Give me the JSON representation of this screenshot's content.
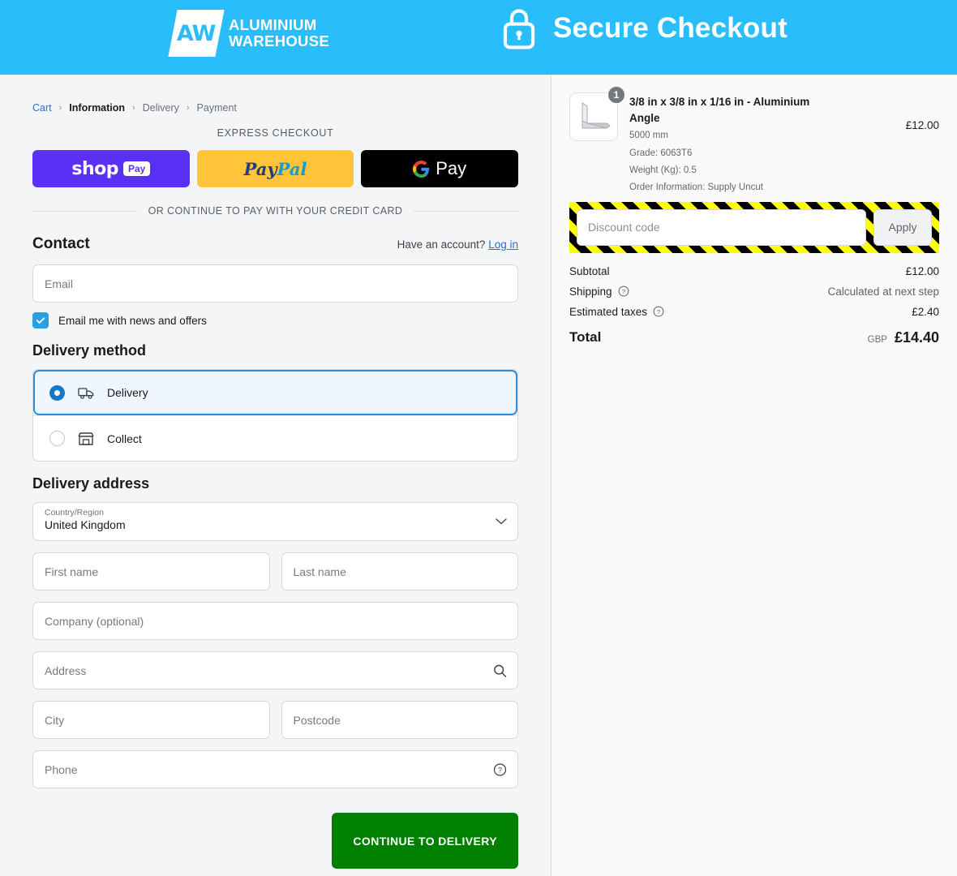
{
  "header": {
    "logo_initials": "AW",
    "brand_line1": "ALUMINIUM",
    "brand_line2": "WAREHOUSE",
    "secure_title": "Secure Checkout",
    "lock_icon": "lock-icon",
    "background_color": "#29bdfb"
  },
  "breadcrumb": {
    "cart": "Cart",
    "information": "Information",
    "delivery": "Delivery",
    "payment": "Payment",
    "separator": "›"
  },
  "express": {
    "title": "EXPRESS CHECKOUT",
    "shop_pay": {
      "word": "shop",
      "chip": "Pay",
      "color": "#5a31f4"
    },
    "paypal": {
      "part1": "Pay",
      "part2": "Pal",
      "color": "#ffc439"
    },
    "gpay": {
      "label": "Pay",
      "color": "#000000"
    },
    "divider_text": "OR CONTINUE TO PAY WITH YOUR CREDIT CARD"
  },
  "contact": {
    "title": "Contact",
    "account_prompt": "Have an account?",
    "login_label": "Log in",
    "email_placeholder": "Email",
    "email_value": "",
    "newsletter_label": "Email me with news and offers",
    "newsletter_checked": true
  },
  "delivery_method": {
    "title": "Delivery method",
    "options": [
      {
        "label": "Delivery",
        "icon": "truck-icon",
        "selected": true
      },
      {
        "label": "Collect",
        "icon": "storefront-icon",
        "selected": false
      }
    ]
  },
  "delivery_address": {
    "title": "Delivery address",
    "country_label": "Country/Region",
    "country_value": "United Kingdom",
    "first_name_placeholder": "First name",
    "last_name_placeholder": "Last name",
    "company_placeholder": "Company (optional)",
    "address_placeholder": "Address",
    "city_placeholder": "City",
    "postcode_placeholder": "Postcode",
    "phone_placeholder": "Phone"
  },
  "submit": {
    "label": "CONTINUE TO DELIVERY",
    "color": "#008000"
  },
  "order_summary": {
    "product": {
      "name": "3/8 in x 3/8 in x 1/16 in - Aluminium Angle",
      "length": "5000 mm",
      "grade": "Grade: 6063T6",
      "weight": "Weight (Kg): 0.5",
      "order_information": "Order Information: Supply Uncut",
      "price": "£12.00",
      "quantity": "1"
    },
    "discount": {
      "placeholder": "Discount code",
      "value": "",
      "apply_label": "Apply",
      "highlight_colors": [
        "#ffff00",
        "#000000"
      ]
    },
    "totals": {
      "subtotal_label": "Subtotal",
      "subtotal_value": "£12.00",
      "shipping_label": "Shipping",
      "shipping_value": "Calculated at next step",
      "taxes_label": "Estimated taxes",
      "taxes_value": "£2.40",
      "total_label": "Total",
      "currency": "GBP",
      "total_value": "£14.40"
    }
  }
}
